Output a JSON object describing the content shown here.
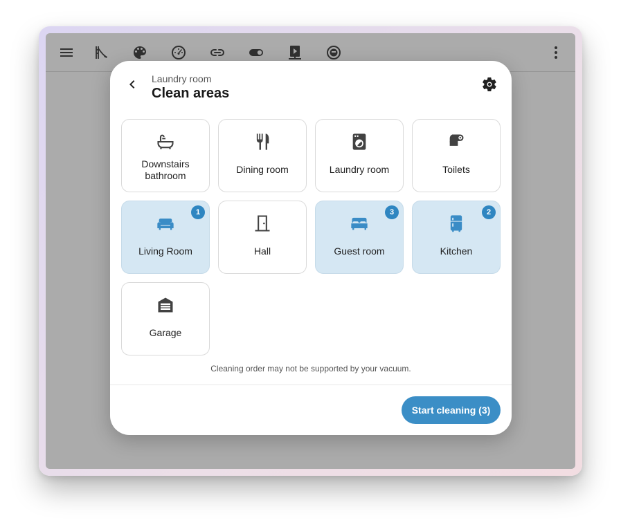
{
  "toolbar": {
    "icons": [
      "menu-icon",
      "slide-icon",
      "palette-icon",
      "gauge-icon",
      "link-icon",
      "toggle-icon",
      "video-icon",
      "robot-vacuum-icon",
      "more-vertical-icon"
    ]
  },
  "dialog": {
    "subtitle": "Laundry room",
    "title": "Clean areas",
    "note": "Cleaning order may not be supported by your vacuum.",
    "start_button": "Start cleaning (3)"
  },
  "areas": [
    {
      "label": "Downstairs bathroom",
      "icon": "bathtub-icon",
      "selected": false,
      "order": ""
    },
    {
      "label": "Dining room",
      "icon": "cutlery-icon",
      "selected": false,
      "order": ""
    },
    {
      "label": "Laundry room",
      "icon": "washing-machine-icon",
      "selected": false,
      "order": ""
    },
    {
      "label": "Toilets",
      "icon": "toilet-paper-icon",
      "selected": false,
      "order": ""
    },
    {
      "label": "Living Room",
      "icon": "sofa-icon",
      "selected": true,
      "order": "1"
    },
    {
      "label": "Hall",
      "icon": "door-icon",
      "selected": false,
      "order": ""
    },
    {
      "label": "Guest room",
      "icon": "bed-icon",
      "selected": true,
      "order": "3"
    },
    {
      "label": "Kitchen",
      "icon": "fridge-icon",
      "selected": true,
      "order": "2"
    },
    {
      "label": "Garage",
      "icon": "garage-icon",
      "selected": false,
      "order": ""
    }
  ],
  "colors": {
    "accent": "#3b8ec6",
    "selected_tile": "#d5e7f3",
    "backdrop": "#ababab"
  }
}
